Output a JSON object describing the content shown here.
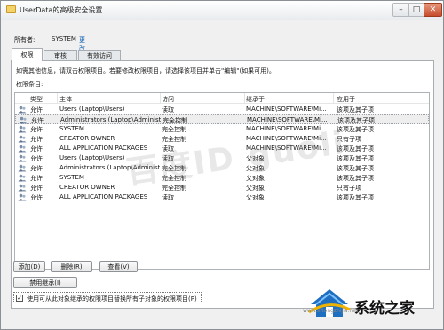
{
  "window": {
    "title": "UserData的高级安全设置",
    "minimize": "–",
    "maximize": "□",
    "close": "✕"
  },
  "owner": {
    "label": "所有者:",
    "value": "SYSTEM",
    "change_link": "更改(C)"
  },
  "tabs": [
    {
      "label": "权限"
    },
    {
      "label": "审核"
    },
    {
      "label": "有效访问"
    }
  ],
  "description": "如需其他信息，请双击权限项目。若要修改权限项目，请选择该项目并单击\"编辑\"(如果可用)。",
  "list_label": "权限条目:",
  "columns": [
    "类型",
    "主体",
    "访问",
    "继承于",
    "应用于"
  ],
  "rows": [
    {
      "type": "允许",
      "principal": "Users (Laptop\\Users)",
      "access": "读取",
      "inherit": "MACHINE\\SOFTWARE\\Mi...",
      "applies": "该项及其子项"
    },
    {
      "type": "允许",
      "principal": "Administrators (Laptop\\Administ...",
      "access": "完全控制",
      "inherit": "MACHINE\\SOFTWARE\\Mi...",
      "applies": "该项及其子项"
    },
    {
      "type": "允许",
      "principal": "SYSTEM",
      "access": "完全控制",
      "inherit": "MACHINE\\SOFTWARE\\Mi...",
      "applies": "该项及其子项"
    },
    {
      "type": "允许",
      "principal": "CREATOR OWNER",
      "access": "完全控制",
      "inherit": "MACHINE\\SOFTWARE\\Mi...",
      "applies": "只有子项"
    },
    {
      "type": "允许",
      "principal": "ALL APPLICATION PACKAGES",
      "access": "读取",
      "inherit": "MACHINE\\SOFTWARE\\Mi...",
      "applies": "该项及其子项"
    },
    {
      "type": "允许",
      "principal": "Users (Laptop\\Users)",
      "access": "读取",
      "inherit": "父对象",
      "applies": "该项及其子项"
    },
    {
      "type": "允许",
      "principal": "Administrators (Laptop\\Administ...",
      "access": "完全控制",
      "inherit": "父对象",
      "applies": "该项及其子项"
    },
    {
      "type": "允许",
      "principal": "SYSTEM",
      "access": "完全控制",
      "inherit": "父对象",
      "applies": "该项及其子项"
    },
    {
      "type": "允许",
      "principal": "CREATOR OWNER",
      "access": "完全控制",
      "inherit": "父对象",
      "applies": "只有子项"
    },
    {
      "type": "允许",
      "principal": "ALL APPLICATION PACKAGES",
      "access": "读取",
      "inherit": "父对象",
      "applies": "该项及其子项"
    }
  ],
  "buttons": {
    "add": "添加(D)",
    "remove": "删除(R)",
    "view": "查看(V)",
    "disable_inheritance": "禁用继承(I)"
  },
  "replace_checkbox": {
    "checked": true,
    "label": "使用可从此对象继承的权限项目替换所有子对象的权限项目(P)"
  },
  "watermark": "百度ID guoli",
  "site_logo": {
    "text": "系统之家",
    "url": "www.xitongzhijia.net"
  },
  "colors": {
    "close_button": "#c64c2c",
    "selected_row": "#eeeeee",
    "link": "#0b5fb5"
  }
}
